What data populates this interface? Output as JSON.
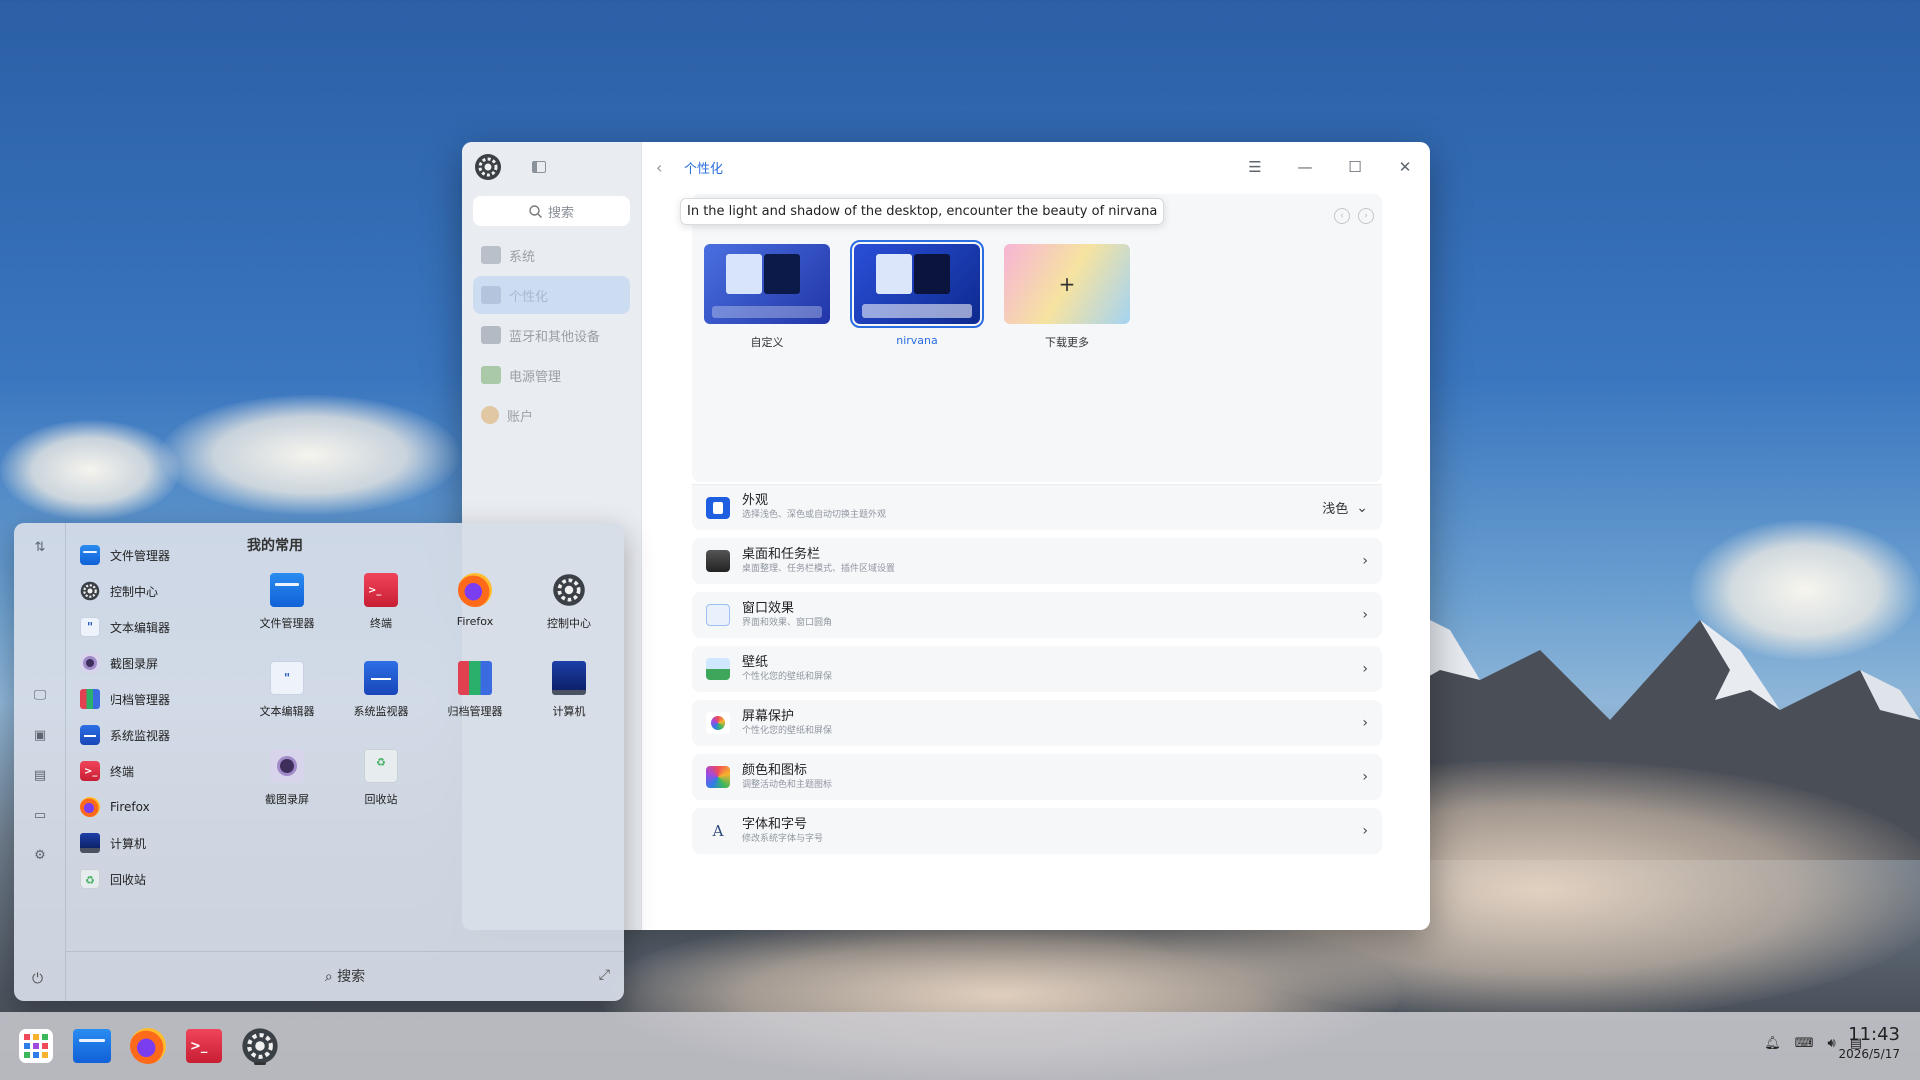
{
  "settings": {
    "sidebar": {
      "search_placeholder": "搜索",
      "items": [
        {
          "label": "系统",
          "icon": "system-icon"
        },
        {
          "label": "个性化",
          "icon": "personalization-icon"
        },
        {
          "label": "蓝牙和其他设备",
          "icon": "bluetooth-devices-icon"
        },
        {
          "label": "电源管理",
          "icon": "power-management-icon"
        },
        {
          "label": "账户",
          "icon": "account-icon"
        }
      ],
      "active_index": 1
    },
    "breadcrumb": "个性化",
    "tooltip": "In the light and shadow of the desktop, encounter the beauty of nirvana",
    "themes": [
      {
        "label": "自定义",
        "selected": false
      },
      {
        "label": "nirvana",
        "selected": true
      },
      {
        "label": "下载更多",
        "selected": false
      }
    ],
    "rows": [
      {
        "title": "外观",
        "subtitle": "选择浅色、深色或自动切换主题外观",
        "value": "浅色",
        "icon": "appearance-icon"
      },
      {
        "title": "桌面和任务栏",
        "subtitle": "桌面整理、任务栏模式、插件区域设置",
        "icon": "desktop-taskbar-icon"
      },
      {
        "title": "窗口效果",
        "subtitle": "界面和效果、窗口圆角",
        "icon": "window-effects-icon"
      },
      {
        "title": "壁纸",
        "subtitle": "个性化您的壁纸和屏保",
        "icon": "wallpaper-icon"
      },
      {
        "title": "屏幕保护",
        "subtitle": "个性化您的壁纸和屏保",
        "icon": "screensaver-icon"
      },
      {
        "title": "颜色和图标",
        "subtitle": "调整活动色和主题图标",
        "icon": "color-icons-icon"
      },
      {
        "title": "字体和字号",
        "subtitle": "修改系统字体与字号",
        "icon": "font-icon"
      }
    ]
  },
  "launcher": {
    "list": [
      "文件管理器",
      "控制中心",
      "文本编辑器",
      "截图录屏",
      "归档管理器",
      "系统监视器",
      "终端",
      "Firefox",
      "计算机",
      "回收站"
    ],
    "favorites_title": "我的常用",
    "favorites": [
      "文件管理器",
      "终端",
      "Firefox",
      "控制中心",
      "文本编辑器",
      "系统监视器",
      "归档管理器",
      "计算机",
      "截图录屏",
      "回收站"
    ],
    "search_label": "搜索"
  },
  "taskbar": {
    "apps": [
      "launcher",
      "file-manager",
      "firefox",
      "terminal",
      "control-center"
    ],
    "time": "11:43",
    "date": "2026/5/17"
  }
}
